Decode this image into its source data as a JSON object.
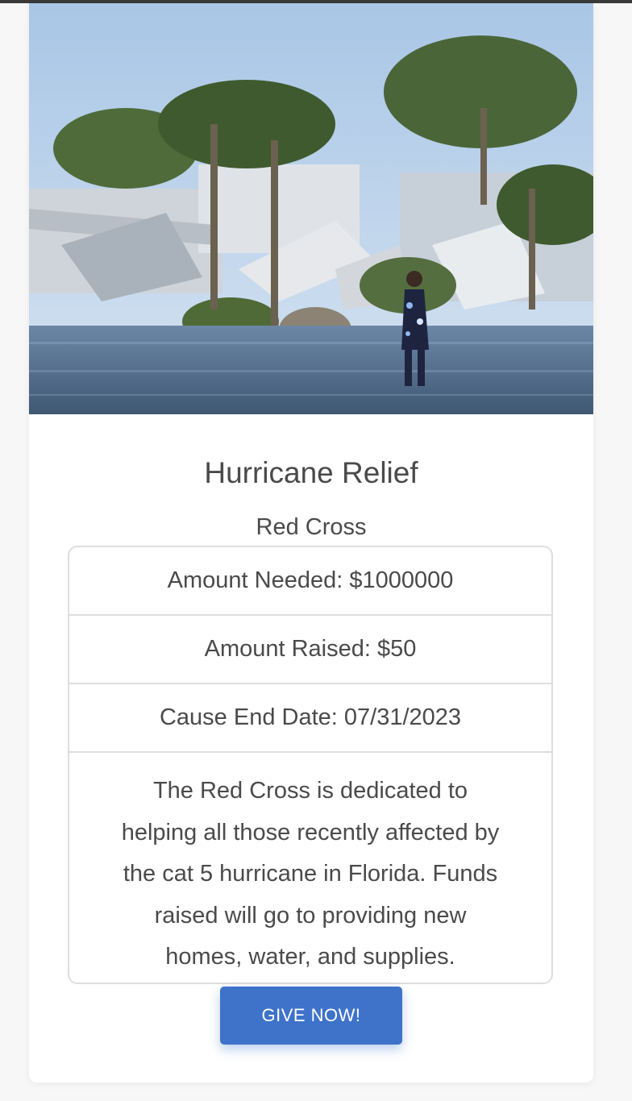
{
  "cause": {
    "image_alt": "Flooded neighborhood with destroyed homes and palm trees after a hurricane",
    "title": "Hurricane Relief",
    "organization": "Red Cross",
    "amount_needed": "Amount Needed: $1000000",
    "amount_raised": "Amount Raised: $50",
    "end_date": "Cause End Date: 07/31/2023",
    "description": "The Red Cross is dedicated to helping all those recently affected by the cat 5 hurricane in Florida. Funds raised will go to providing new homes, water, and supplies.",
    "button_label": "GIVE NOW!"
  },
  "colors": {
    "accent": "#3e73c9",
    "text": "#4a4a4a",
    "border": "#dedede"
  }
}
